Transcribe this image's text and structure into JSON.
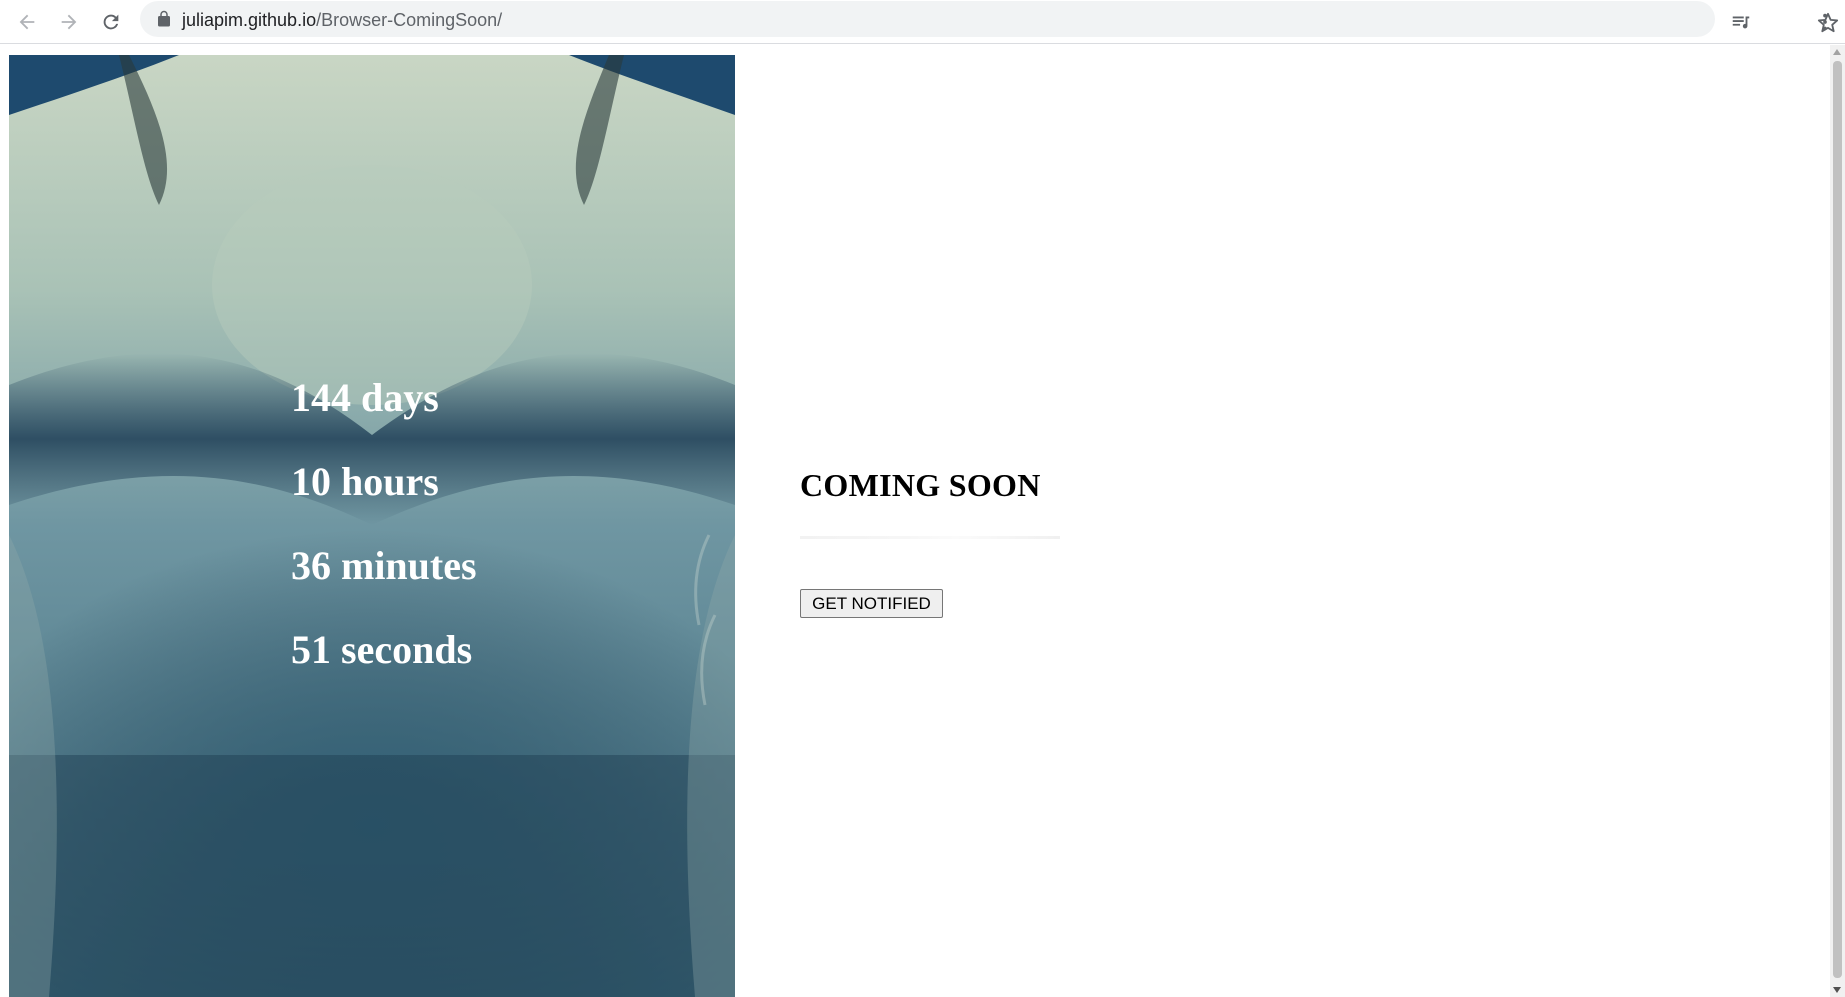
{
  "browser": {
    "url_host": "juliapim.github.io",
    "url_path": "/Browser-ComingSoon/",
    "icons": {
      "back": "back-arrow-icon",
      "forward": "forward-arrow-icon",
      "reload": "reload-icon",
      "lock": "lock-icon",
      "bookmark": "star-icon",
      "media": "media-queue-icon",
      "menu": "kebab-menu-icon"
    }
  },
  "page": {
    "countdown": {
      "days": "144 days",
      "hours": "10 hours",
      "minutes": "36 minutes",
      "seconds": "51 seconds"
    },
    "heading": "COMING SOON",
    "notify_button": "GET NOTIFIED",
    "colors": {
      "countdown_text": "#ffffff",
      "heading_text": "#000000",
      "hero_tint": "#2f5f73"
    }
  }
}
